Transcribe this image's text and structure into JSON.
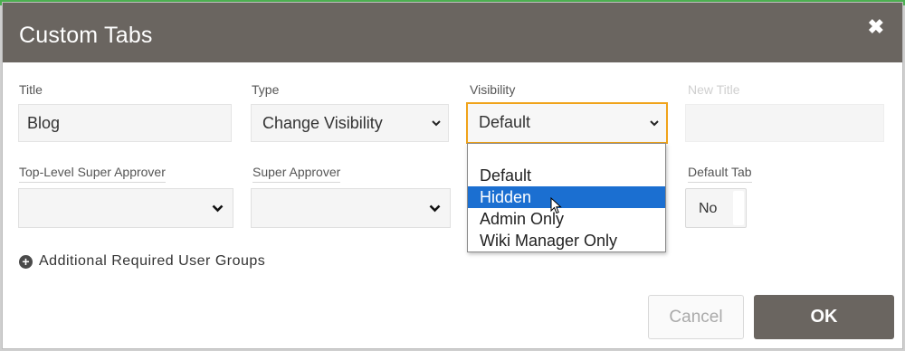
{
  "dialog": {
    "title": "Custom Tabs",
    "close_icon": "close-icon"
  },
  "fields": {
    "title_label": "Title",
    "title_value": "Blog",
    "type_label": "Type",
    "type_value": "Change Visibility",
    "visibility_label": "Visibility",
    "visibility_value": "Default",
    "new_title_label": "New Title",
    "new_title_value": "",
    "top_level_label": "Top-Level Super Approver",
    "super_approver_label": "Super Approver",
    "default_tab_label": "Default Tab",
    "default_tab_value": "No"
  },
  "visibility_options": [
    "Default",
    "Hidden",
    "Admin Only",
    "Wiki Manager Only"
  ],
  "highlighted_option": "Hidden",
  "additional_groups_label": "Additional Required User Groups",
  "buttons": {
    "cancel": "Cancel",
    "ok": "OK"
  },
  "colors": {
    "header_bg": "#6a6560",
    "focus_border": "#f0a31a",
    "highlight_bg": "#1b6fd1"
  }
}
